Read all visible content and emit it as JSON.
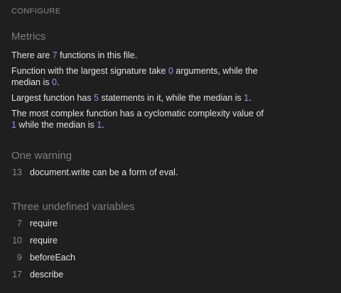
{
  "header": {
    "configure_label": "CONFIGURE"
  },
  "metrics": {
    "title": "Metrics",
    "line1": {
      "pre": "There are ",
      "num": "7",
      "post": " functions in this file."
    },
    "line2": {
      "pre": "Function with the largest signature take ",
      "num1": "0",
      "mid": " arguments, while the median is ",
      "num2": "0",
      "post": "."
    },
    "line3": {
      "pre": "Largest function has ",
      "num1": "5",
      "mid": " statements in it, while the median is ",
      "num2": "1",
      "post": "."
    },
    "line4": {
      "pre": "The most complex function has a cyclomatic complexity value of ",
      "num1": "1",
      "mid": " while the median is ",
      "num2": "1",
      "post": "."
    }
  },
  "warnings": {
    "title": "One warning",
    "items": [
      {
        "line": "13",
        "text": "document.write can be a form of eval."
      }
    ]
  },
  "undefined_vars": {
    "title": "Three undefined variables",
    "items": [
      {
        "line": "7",
        "text": "require"
      },
      {
        "line": "10",
        "text": "require"
      },
      {
        "line": "9",
        "text": "beforeEach"
      },
      {
        "line": "17",
        "text": "describe"
      }
    ]
  },
  "colors": {
    "background": "#1f1f1f",
    "number_accent": "#8e96ff",
    "muted": "#8a8a8a"
  }
}
